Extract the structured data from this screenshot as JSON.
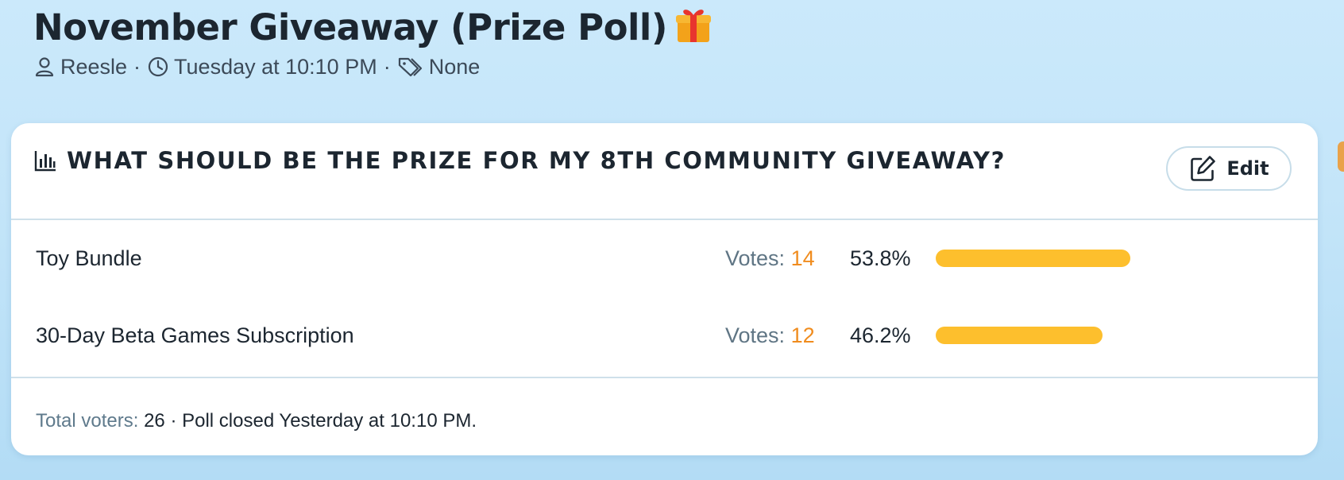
{
  "thread": {
    "title": "November Giveaway (Prize Poll)",
    "title_emoji_icon": "gift-icon",
    "author": "Reesle",
    "posted": "Tuesday at 10:10 PM",
    "tags": "None",
    "meta_separator": "·"
  },
  "poll": {
    "question": "WHAT SHOULD BE THE PRIZE FOR MY 8TH COMMUNITY GIVEAWAY?",
    "question_icon": "bar-chart-icon",
    "edit_label": "Edit",
    "votes_prefix": "Votes:",
    "options": [
      {
        "label": "Toy Bundle",
        "votes": "14",
        "percent": "53.8%",
        "fill_fraction": 0.538
      },
      {
        "label": "30-Day Beta Games Subscription",
        "votes": "12",
        "percent": "46.2%",
        "fill_fraction": 0.462
      }
    ],
    "footer": {
      "total_label": "Total voters:",
      "total_value": "26",
      "separator": "·",
      "closed_text": "Poll closed Yesterday at 10:10 PM."
    }
  },
  "colors": {
    "background": "#c4e5f9",
    "bar_fill": "#fdbf2d",
    "vote_count": "#f08c1e",
    "muted_text": "#5f7584"
  }
}
